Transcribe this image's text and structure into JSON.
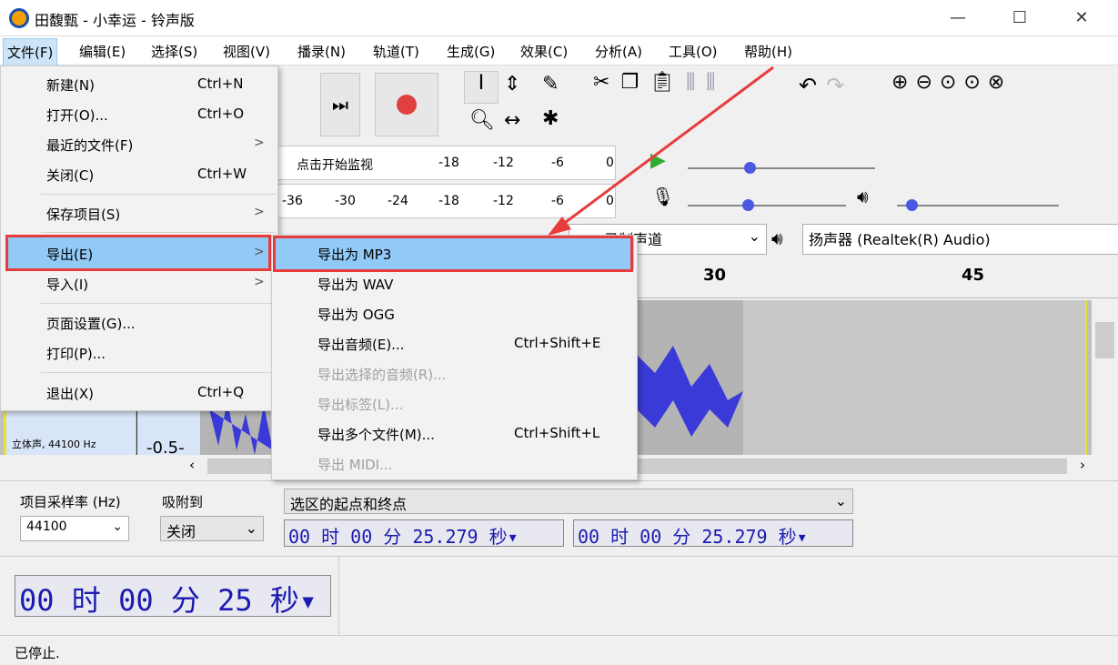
{
  "window": {
    "title": "田馥甄 - 小幸运 - 铃声版",
    "minimize": "—",
    "maximize": "☐",
    "close": "✕"
  },
  "menubar": [
    "文件(F)",
    "编辑(E)",
    "选择(S)",
    "视图(V)",
    "播录(N)",
    "轨道(T)",
    "生成(G)",
    "效果(C)",
    "分析(A)",
    "工具(O)",
    "帮助(H)"
  ],
  "file_menu": [
    {
      "label": "新建(N)",
      "shortcut": "Ctrl+N"
    },
    {
      "label": "打开(O)...",
      "shortcut": "Ctrl+O"
    },
    {
      "label": "最近的文件(F)",
      "submenu": ">"
    },
    {
      "label": "关闭(C)",
      "shortcut": "Ctrl+W"
    },
    {
      "label": "保存项目(S)",
      "submenu": ">"
    },
    {
      "label": "导出(E)",
      "submenu": ">"
    },
    {
      "label": "导入(I)",
      "submenu": ">"
    },
    {
      "label": "页面设置(G)..."
    },
    {
      "label": "打印(P)..."
    },
    {
      "label": "退出(X)",
      "shortcut": "Ctrl+Q"
    }
  ],
  "export_menu": [
    {
      "label": "导出为 MP3"
    },
    {
      "label": "导出为 WAV"
    },
    {
      "label": "导出为 OGG"
    },
    {
      "label": "导出音频(E)...",
      "shortcut": "Ctrl+Shift+E"
    },
    {
      "label": "导出选择的音频(R)..."
    },
    {
      "label": "导出标签(L)..."
    },
    {
      "label": "导出多个文件(M)...",
      "shortcut": "Ctrl+Shift+L"
    },
    {
      "label": "导出 MIDI..."
    }
  ],
  "meters": {
    "monitor_hint": "点击开始监视",
    "record_ticks": [
      "-18",
      "-12",
      "-6",
      "0"
    ],
    "play_ticks": [
      "-36",
      "-30",
      "-24",
      "-18",
      "-12",
      "-6",
      "0"
    ]
  },
  "devices": {
    "channels": "录制声道",
    "output": "扬声器 (Realtek(R) Audio)"
  },
  "ruler": [
    "30",
    "45"
  ],
  "track": {
    "info": "立体声, 44100 Hz",
    "scale": "-0.5-"
  },
  "selection_toolbar": {
    "rate_label": "项目采样率 (Hz)",
    "rate_value": "44100",
    "snap_label": "吸附到",
    "snap_value": "关闭",
    "mode": "选区的起点和终点",
    "start": "00 时 00 分 25.279 秒",
    "end": "00 时 00 分 25.279 秒"
  },
  "time_display": "00 时 00 分 25 秒",
  "status": "已停止.",
  "colors": {
    "highlight": "#91c9f7",
    "annotation": "#e83c3c",
    "waveform": "#3a3ad8"
  }
}
